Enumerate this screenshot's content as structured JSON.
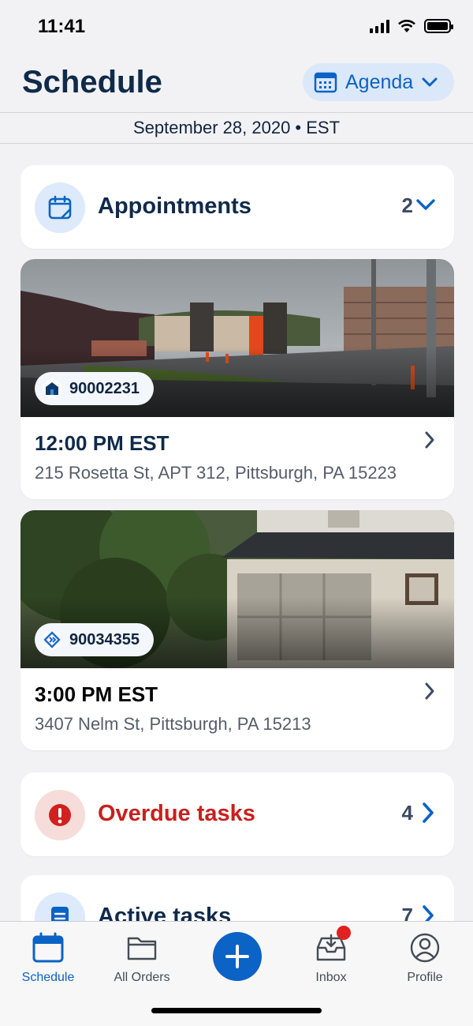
{
  "status_bar": {
    "time": "11:41"
  },
  "header": {
    "title": "Schedule",
    "view_toggle_label": "Agenda"
  },
  "date_bar": {
    "text": "September 28, 2020 • EST"
  },
  "appointments_section": {
    "label": "Appointments",
    "count": "2"
  },
  "appointments": [
    {
      "order_id": "90002231",
      "time": "12:00 PM EST",
      "address": "215 Rosetta St, APT 312, Pittsburgh, PA 15223"
    },
    {
      "order_id": "90034355",
      "time": "3:00 PM EST",
      "address": "3407 Nelm St, Pittsburgh, PA 15213"
    }
  ],
  "overdue_section": {
    "label": "Overdue tasks",
    "count": "4"
  },
  "active_section": {
    "label": "Active tasks",
    "count": "7"
  },
  "tab_bar": {
    "tabs": [
      {
        "label": "Schedule",
        "icon": "calendar-icon",
        "active": true
      },
      {
        "label": "All Orders",
        "icon": "folder-icon",
        "active": false
      },
      {
        "label": "",
        "icon": "plus-icon",
        "active": false
      },
      {
        "label": "Inbox",
        "icon": "inbox-icon",
        "active": false
      },
      {
        "label": "Profile",
        "icon": "person-icon",
        "active": false
      }
    ]
  },
  "colors": {
    "brand_blue": "#0b63c5",
    "alert_red": "#d0201f",
    "title_navy": "#0f2a4a",
    "background": "#f2f2f4"
  }
}
